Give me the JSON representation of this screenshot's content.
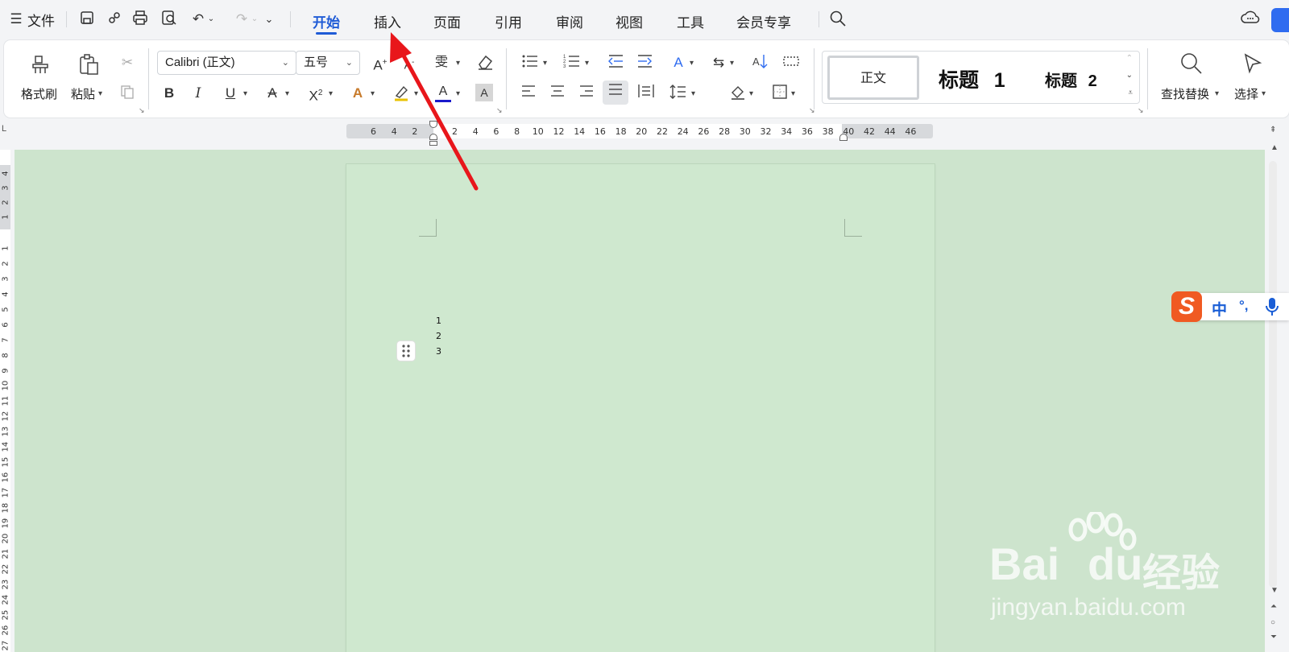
{
  "menubar": {
    "file_label": "文件",
    "tabs": [
      {
        "label": "开始",
        "active": true
      },
      {
        "label": "插入",
        "active": false
      },
      {
        "label": "页面",
        "active": false
      },
      {
        "label": "引用",
        "active": false
      },
      {
        "label": "审阅",
        "active": false
      },
      {
        "label": "视图",
        "active": false
      },
      {
        "label": "工具",
        "active": false
      },
      {
        "label": "会员专享",
        "active": false
      }
    ]
  },
  "ribbon": {
    "format_painter": "格式刷",
    "paste": "粘贴",
    "font_name": "Calibri (正文)",
    "font_size": "五号",
    "styles": {
      "normal": "正文",
      "heading1": "标题",
      "heading1_num": "1",
      "heading2": "标题",
      "heading2_num": "2"
    },
    "find_replace": "查找替换",
    "select": "选择"
  },
  "ruler": {
    "horizontal_ticks": [
      "6",
      "4",
      "2",
      "2",
      "4",
      "6",
      "8",
      "10",
      "12",
      "14",
      "16",
      "18",
      "20",
      "22",
      "24",
      "26",
      "28",
      "30",
      "32",
      "34",
      "36",
      "38",
      "40",
      "42",
      "44",
      "46"
    ],
    "vertical_ticks_top": [
      "4",
      "3",
      "2",
      "1"
    ],
    "vertical_ticks": [
      "1",
      "2",
      "3",
      "4",
      "5",
      "6",
      "7",
      "8",
      "9",
      "10",
      "11",
      "12",
      "13",
      "14",
      "15",
      "16",
      "17",
      "18",
      "19",
      "20",
      "21",
      "22",
      "23",
      "24",
      "25",
      "26",
      "27"
    ]
  },
  "document": {
    "lines": [
      "1",
      "2",
      "3"
    ]
  },
  "ime": {
    "mode": "中",
    "punct": "°,"
  },
  "watermark": {
    "brand": "Bai",
    "brand2": "du",
    "cn": "经验",
    "url": "jingyan.baidu.com"
  },
  "colors": {
    "accent": "#1f5bd6",
    "page_bg": "#cfe8cf",
    "workspace_bg": "#cde4cd",
    "arrow": "#e8161b"
  }
}
